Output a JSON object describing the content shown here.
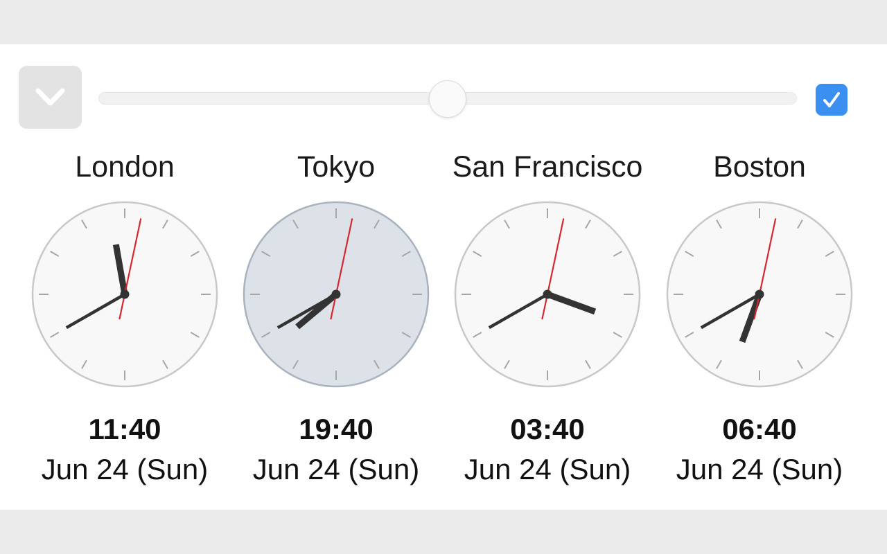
{
  "toolbar": {
    "collapse_icon": "chevron-down-icon",
    "slider_value": 0.5,
    "checkbox_checked": true,
    "checkbox_icon": "checkmark-icon"
  },
  "colors": {
    "accent": "#3b8ff0",
    "second_hand": "#d6262e",
    "hand": "#333333",
    "highlight_face": "#dde2e8"
  },
  "clocks": [
    {
      "city": "London",
      "time": "11:40",
      "date": "Jun 24 (Sun)",
      "hour": 11,
      "minute": 40,
      "second": 2,
      "highlighted": false
    },
    {
      "city": "Tokyo",
      "time": "19:40",
      "date": "Jun 24 (Sun)",
      "hour": 19,
      "minute": 40,
      "second": 2,
      "highlighted": true
    },
    {
      "city": "San Francisco",
      "time": "03:40",
      "date": "Jun 24 (Sun)",
      "hour": 3,
      "minute": 40,
      "second": 2,
      "highlighted": false
    },
    {
      "city": "Boston",
      "time": "06:40",
      "date": "Jun 24 (Sun)",
      "hour": 6,
      "minute": 40,
      "second": 2,
      "highlighted": false
    }
  ]
}
